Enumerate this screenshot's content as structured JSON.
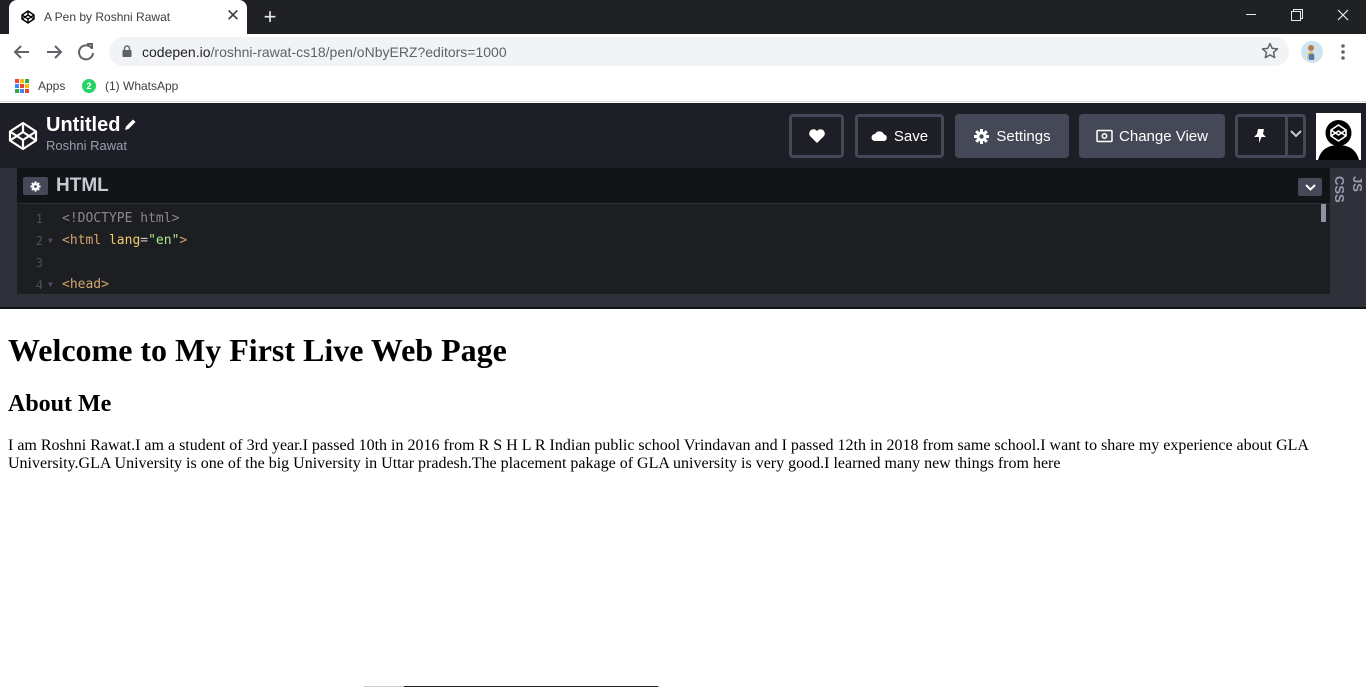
{
  "browser": {
    "tab": {
      "title": "A Pen by Roshni Rawat"
    },
    "address_bar": {
      "domain": "codepen.io",
      "path": "/roshni-rawat-cs18/pen/oNbyERZ?editors=1000"
    },
    "bookmarks": [
      {
        "label": "Apps",
        "icon": "apps-grid-icon"
      },
      {
        "label": "(1) WhatsApp",
        "icon": "whatsapp-icon",
        "badge": "2"
      }
    ]
  },
  "codepen": {
    "pen_title": "Untitled",
    "author": "Roshni Rawat",
    "buttons": {
      "save": "Save",
      "settings": "Settings",
      "change_view": "Change View"
    },
    "editor": {
      "language": "HTML",
      "side_tabs": [
        "CSS",
        "JS"
      ],
      "line_numbers": [
        "1",
        "2",
        "3",
        "4"
      ],
      "lines": [
        {
          "tokens": [
            {
              "t": "<!DOCTYPE html>",
              "k": "doc"
            }
          ]
        },
        {
          "tokens": [
            {
              "t": "<html",
              "k": "tag"
            },
            {
              "t": " lang",
              "k": "attr"
            },
            {
              "t": "=",
              "k": "plain"
            },
            {
              "t": "\"en\"",
              "k": "str"
            },
            {
              "t": ">",
              "k": "tag"
            }
          ]
        },
        {
          "tokens": []
        },
        {
          "tokens": [
            {
              "t": "<head>",
              "k": "tag"
            }
          ]
        }
      ]
    },
    "colors": {
      "header_bg": "#1e1f26",
      "button_bg": "#444857",
      "editor_bg": "#1d1e22"
    }
  },
  "preview": {
    "heading": "Welcome to My First Live Web Page",
    "subheading": "About Me",
    "paragraph": "I am Roshni Rawat.I am a student of 3rd year.I passed 10th in 2016 from R S H L R Indian public school Vrindavan and I passed 12th in 2018 from same school.I want to share my experience about GLA University.GLA University is one of the big University in Uttar pradesh.The placement pakage of GLA university is very good.I learned many new things from here"
  }
}
